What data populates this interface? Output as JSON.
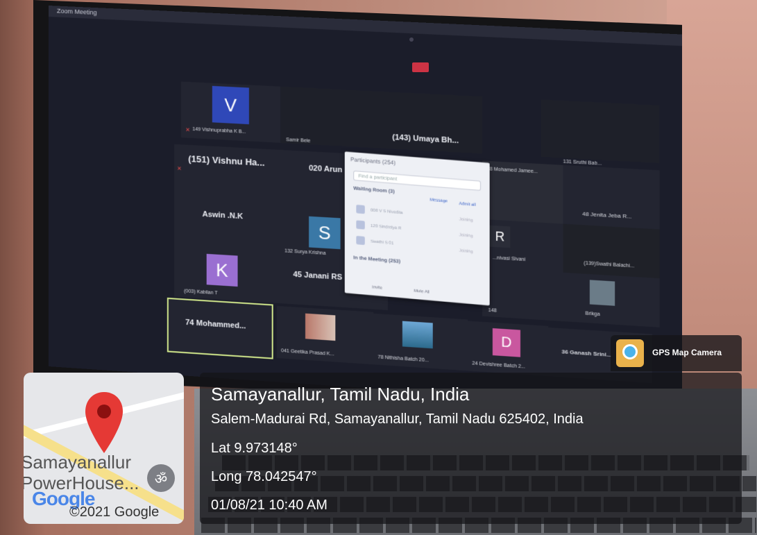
{
  "zoom": {
    "window_title": "Zoom Meeting",
    "tiles": [
      {
        "avatar": "V",
        "label": "149 Vishnuprabha K B..."
      },
      {
        "label": "Samir Bele"
      },
      {
        "label": "(143) Umaya Bh..."
      },
      {
        "label": "131 Sruthi Bab..."
      },
      {
        "label": "(151) Vishnu Ha..."
      },
      {
        "label": "020 Arun"
      },
      {
        "label": "48 Mohamed Jamee..."
      },
      {
        "label": "48 Jenita Jeba R..."
      },
      {
        "label": "Aswin .N.K"
      },
      {
        "avatar": "S",
        "label": "132 Surya Krishna"
      },
      {
        "avatar": "R",
        "label": "...nivasi Sivani"
      },
      {
        "label": "(139)Swathi Balachi..."
      },
      {
        "avatar": "K",
        "label": "(003) Kabilan T"
      },
      {
        "label": "45 Janani RS"
      },
      {
        "label": "148"
      },
      {
        "label": "Brikga"
      },
      {
        "label": "74 Mohammed..."
      },
      {
        "label": "041 Geetika Prasad K..."
      },
      {
        "label": "78 Nithisha Batch 20..."
      },
      {
        "avatar": "D",
        "label": "24 Devishree Batch 2..."
      },
      {
        "label": "36 Ganash Srini..."
      }
    ],
    "participants_panel": {
      "title": "Participants (254)",
      "search_placeholder": "Find a participant",
      "waiting_room": "Waiting Room (3)",
      "message": "Message",
      "admit_all": "Admit all",
      "waiting": [
        "008 V S Nivedita",
        "120 Sindrelya R",
        "Swathi S 01"
      ],
      "waiting_status": "Joining",
      "in_meeting": "In the Meeting (253)",
      "invite": "Invite",
      "mute_all": "Mute All"
    }
  },
  "gps": {
    "app_name": "GPS Map Camera",
    "map_place": "Samayanallur PowerHouse...",
    "map_logo": "Google",
    "map_copyright": "©2021 Google",
    "location_title": "Samayanallur, Tamil Nadu, India",
    "address": "Salem-Madurai Rd, Samayanallur, Tamil Nadu 625402, India",
    "lat": "Lat 9.973148°",
    "long": "Long 78.042547°",
    "datetime": "01/08/21 10:40 AM"
  }
}
